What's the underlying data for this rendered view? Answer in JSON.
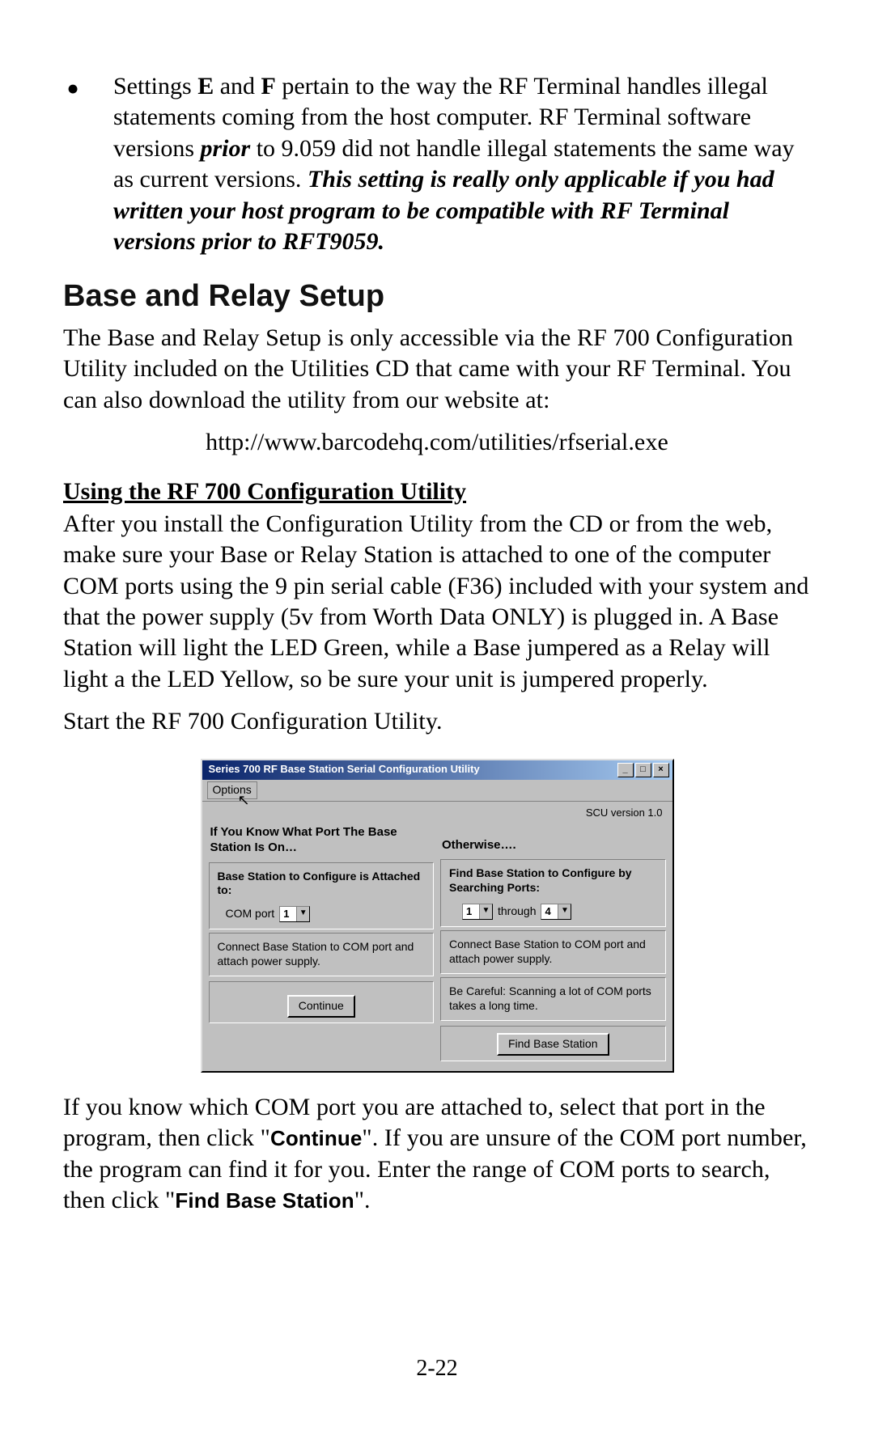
{
  "bullet": {
    "pre": "Settings ",
    "e": "E",
    "and": " and ",
    "f": "F",
    "mid1": " pertain to the way the RF Terminal handles illegal statements coming from the host computer. RF Terminal software versions ",
    "prior": "prior",
    "mid2": " to 9.059 did not handle illegal statements the same way as current versions. ",
    "bolditalic": "This setting is really only applicable if you had written your host program to be compatible with RF Terminal versions prior to RFT9059."
  },
  "h1": "Base and Relay Setup",
  "intro": "The Base and Relay Setup is only accessible via the RF 700 Configuration Utility included on the Utilities CD that came with your RF Terminal. You can also download the utility from our website at:",
  "url": "http://www.barcodehq.com/utilities/rfserial.exe",
  "subhead": "Using the RF 700 Configuration Utility",
  "after_sub": "After you install the Configuration Utility from the CD or from the web, make sure your Base or Relay Station is attached to one of the computer COM ports using the 9 pin serial cable (F36) included with your system and that the power supply (5v from Worth Data ONLY) is plugged in. A Base Station will light the LED Green,  while a Base jumpered as a Relay will light a the LED Yellow, so be sure your unit is jumpered properly.",
  "start": "Start the RF 700 Configuration Utility.",
  "win": {
    "title": "Series 700 RF Base Station Serial Configuration Utility",
    "menu_options": "Options",
    "scu_version": "SCU version 1.0",
    "left_head": "If You Know What Port The Base Station Is On…",
    "right_head": "Otherwise….",
    "left_box1_b": "Base Station to Configure is Attached to:",
    "com_label": "COM port",
    "com_value": "1",
    "left_box2": "Connect Base Station to COM port and attach power supply.",
    "left_btn": "Continue",
    "right_box1_b": "Find Base Station to Configure by Searching Ports:",
    "right_from": "1",
    "right_through": "through",
    "right_to": "4",
    "right_box2": "Connect Base Station to COM port and attach power supply.",
    "right_box3": "Be Careful: Scanning a lot of COM ports takes a long time.",
    "right_btn": "Find Base Station",
    "btn_min": "_",
    "btn_max": "□",
    "btn_close": "×"
  },
  "tail": {
    "a": "If you know which COM port you are attached to, select that port in the program, then click \"",
    "b1": "Continue",
    "c": "\". If you are unsure of the COM port number, the program can find it for you.  Enter the range of COM ports to search, then click \"",
    "b2": "Find Base Station",
    "d": "\"."
  },
  "pagenum": "2-22"
}
